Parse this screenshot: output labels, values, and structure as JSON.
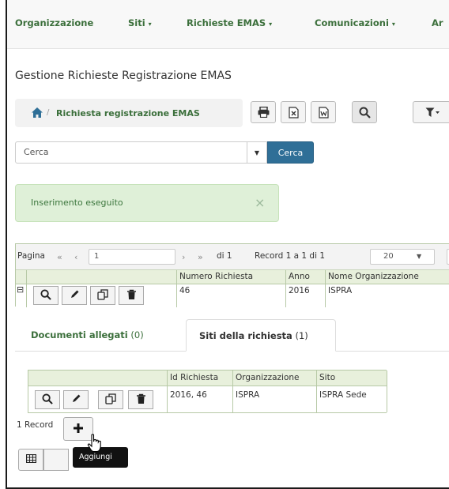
{
  "navbar": {
    "items": [
      {
        "label": "Organizzazione",
        "has_caret": false
      },
      {
        "label": "Siti",
        "has_caret": true
      },
      {
        "label": "Richieste EMAS",
        "has_caret": true
      },
      {
        "label": "Comunicazioni",
        "has_caret": true
      },
      {
        "label": "Ar",
        "has_caret": false
      }
    ],
    "caret": "▾"
  },
  "page": {
    "title": "Gestione Richieste Registrazione EMAS"
  },
  "breadcrumb": {
    "separator": "/",
    "current": "Richiesta registrazione EMAS"
  },
  "toolbar": {
    "buttons": [
      "print-icon",
      "excel-icon",
      "word-icon",
      "search-icon",
      "filter-icon"
    ]
  },
  "search": {
    "placeholder": "Cerca",
    "button_label": "Cerca"
  },
  "alert": {
    "message": "Inserimento eseguito",
    "close": "×"
  },
  "pager": {
    "page_label": "Pagina",
    "page_value": "1",
    "of_label": "di 1",
    "record_label": "Record 1 a 1 di 1",
    "page_size": "20"
  },
  "main_grid": {
    "columns": [
      "Numero Richiesta",
      "Anno",
      "Nome Organizzazione"
    ],
    "rows": [
      {
        "numero": "46",
        "anno": "2016",
        "nome": "ISPRA"
      }
    ]
  },
  "tabs": [
    {
      "label": "Documenti allegati",
      "count": "(0)"
    },
    {
      "label": "Siti della richiesta",
      "count": "(1)"
    }
  ],
  "sub_grid": {
    "columns": [
      "Id Richiesta",
      "Organizzazione",
      "Sito"
    ],
    "rows": [
      {
        "id": "2016, 46",
        "org": "ISPRA",
        "sito": "ISPRA Sede"
      }
    ]
  },
  "footer": {
    "record_count": "1 Record",
    "add_tooltip": "Aggiungi"
  },
  "colors": {
    "nav_text": "#3b6f3b",
    "search_button": "#2f6f97",
    "alert_bg": "#dff0d8",
    "grid_header": "#e8f0dc"
  }
}
